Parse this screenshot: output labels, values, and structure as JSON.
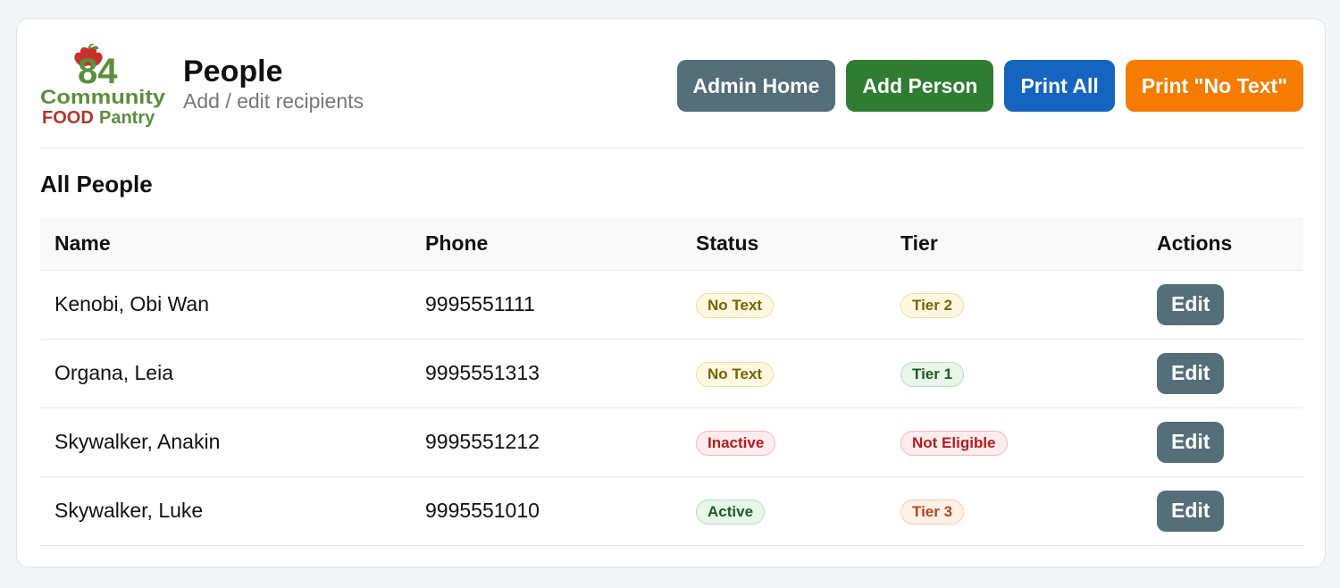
{
  "header": {
    "logo": {
      "number": "84",
      "line1": "Community",
      "line2_part1": "FOOD",
      "line2_part2": "Pantry"
    },
    "title": "People",
    "subtitle": "Add / edit recipients",
    "buttons": {
      "admin_home": "Admin Home",
      "add_person": "Add Person",
      "print_all": "Print All",
      "print_no_text": "Print \"No Text\""
    }
  },
  "section_title": "All People",
  "table": {
    "columns": [
      "Name",
      "Phone",
      "Status",
      "Tier",
      "Actions"
    ],
    "rows": [
      {
        "name": "Kenobi, Obi Wan",
        "phone": "9995551111",
        "status": {
          "label": "No Text",
          "text": "#7a6200",
          "bg": "#fff8e1",
          "border": "#f2de9c"
        },
        "tier": {
          "label": "Tier 2",
          "text": "#7a6200",
          "bg": "#fff8e1",
          "border": "#f2de9c"
        },
        "action": "Edit"
      },
      {
        "name": "Organa, Leia",
        "phone": "9995551313",
        "status": {
          "label": "No Text",
          "text": "#7a6200",
          "bg": "#fff8e1",
          "border": "#f2de9c"
        },
        "tier": {
          "label": "Tier 1",
          "text": "#1b5e20",
          "bg": "#e8f5e9",
          "border": "#b9dfbd"
        },
        "action": "Edit"
      },
      {
        "name": "Skywalker, Anakin",
        "phone": "9995551212",
        "status": {
          "label": "Inactive",
          "text": "#b71c1c",
          "bg": "#fdecee",
          "border": "#f5b8bf"
        },
        "tier": {
          "label": "Not Eligible",
          "text": "#b71c1c",
          "bg": "#fdecee",
          "border": "#f5b8bf"
        },
        "action": "Edit"
      },
      {
        "name": "Skywalker, Luke",
        "phone": "9995551010",
        "status": {
          "label": "Active",
          "text": "#1b5e20",
          "bg": "#e8f5e9",
          "border": "#b9dfbd"
        },
        "tier": {
          "label": "Tier 3",
          "text": "#c0421a",
          "bg": "#fff1e6",
          "border": "#f6c9a8"
        },
        "action": "Edit"
      }
    ]
  },
  "colors": {
    "admin_home": "#546e7a",
    "add_person": "#2e7d32",
    "print_all": "#1565c0",
    "print_no_text": "#f57c00",
    "logo_green": "#5a8f3c",
    "logo_red": "#b5332a"
  }
}
